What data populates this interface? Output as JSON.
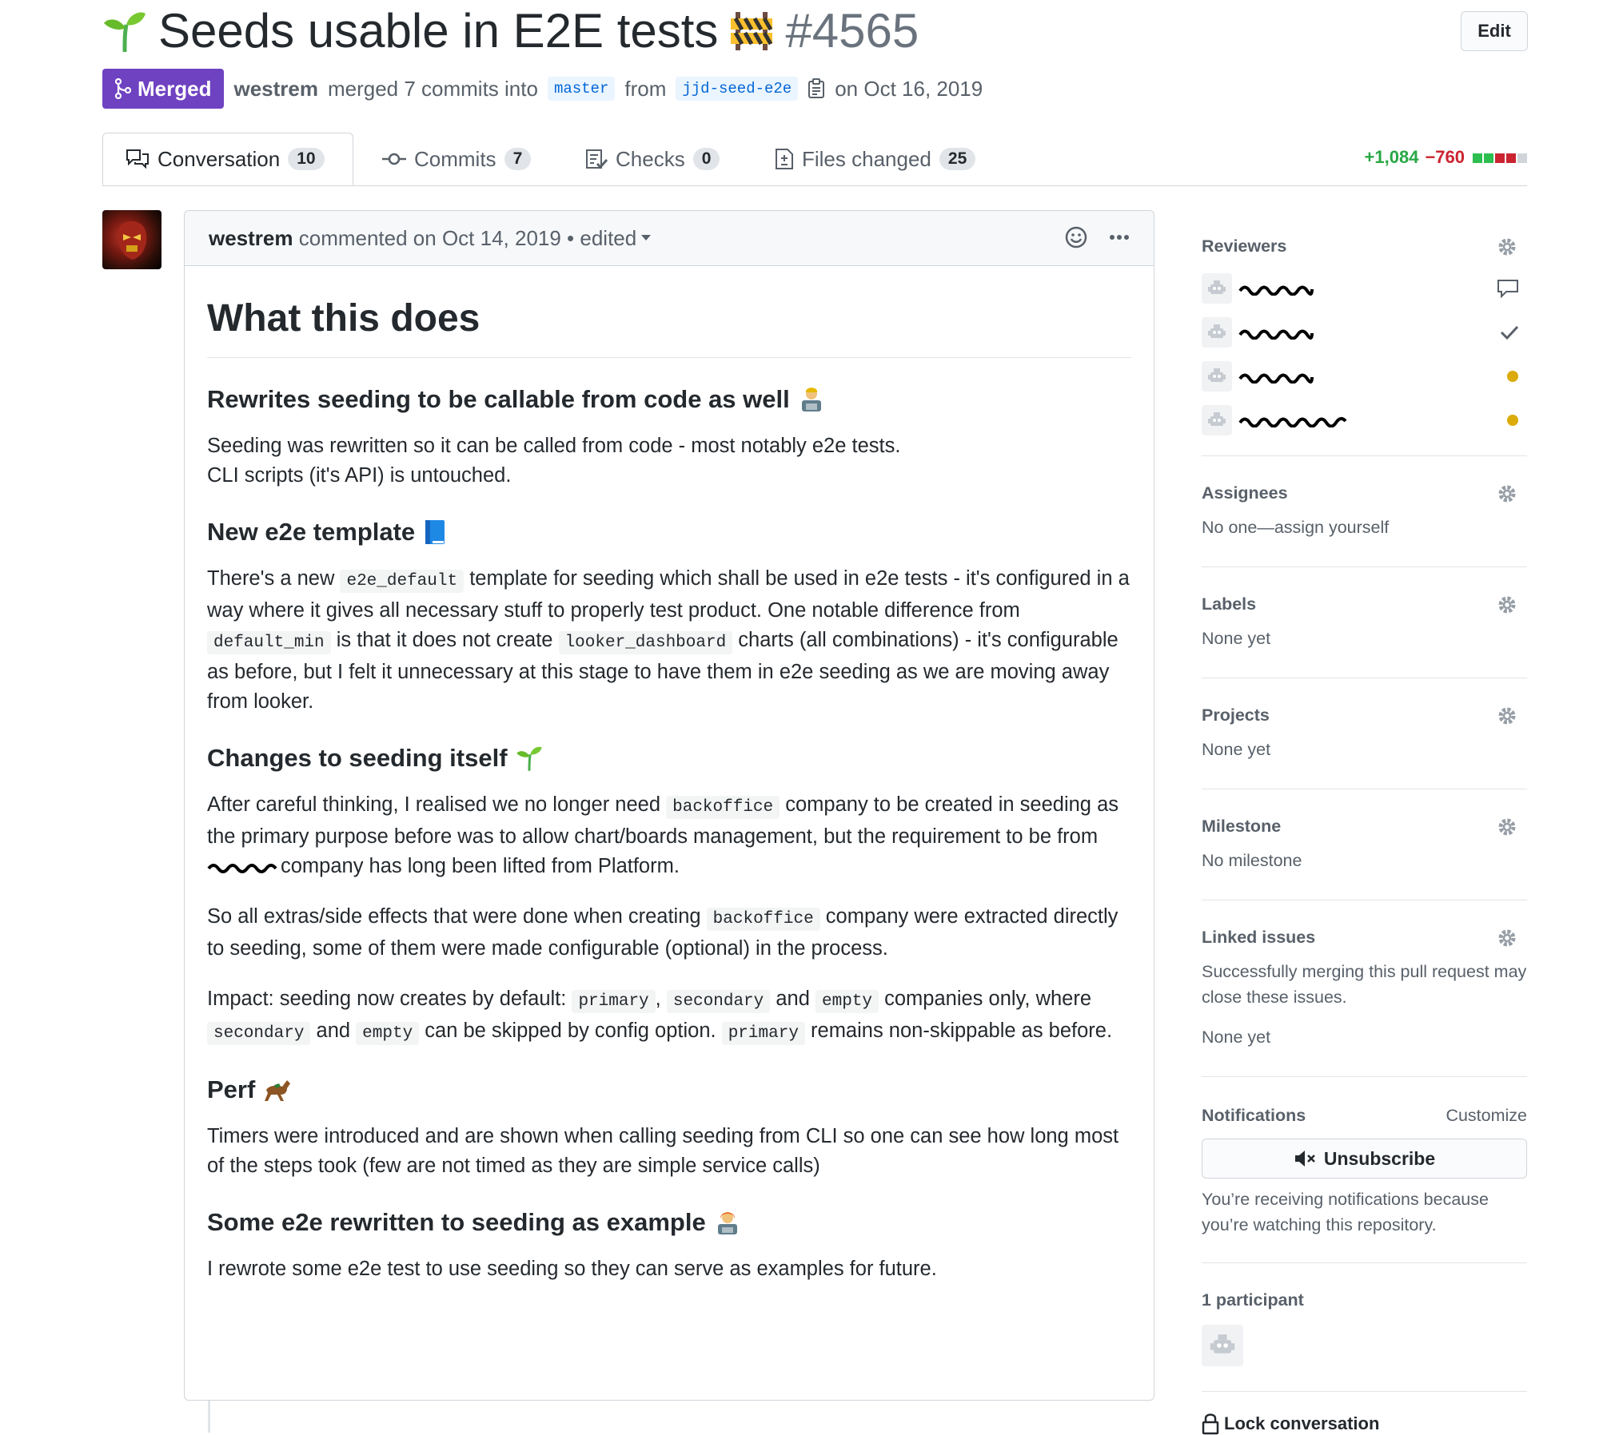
{
  "header": {
    "title": "Seeds usable in E2E tests",
    "number": "#4565",
    "edit_label": "Edit",
    "status": "Merged",
    "author": "westrem",
    "merged_text": "merged 7 commits into",
    "base_branch": "master",
    "from_text": "from",
    "head_branch": "jjd-seed-e2e",
    "date_text": "on Oct 16, 2019"
  },
  "tabs": [
    {
      "label": "Conversation",
      "count": "10",
      "icon": "comment-discussion-icon"
    },
    {
      "label": "Commits",
      "count": "7",
      "icon": "git-commit-icon"
    },
    {
      "label": "Checks",
      "count": "0",
      "icon": "checklist-icon"
    },
    {
      "label": "Files changed",
      "count": "25",
      "icon": "file-diff-icon"
    }
  ],
  "diffstat": {
    "additions": "+1,084",
    "deletions": "−760"
  },
  "comment": {
    "author": "westrem",
    "meta": "commented on Oct 14, 2019",
    "edited": "edited",
    "h1": "What this does",
    "sections": {
      "s1": {
        "heading": "Rewrites seeding to be callable from code as well",
        "p1_line1": "Seeding was rewritten so it can be called from code - most notably e2e tests.",
        "p1_line2": "CLI scripts (it's API) is untouched."
      },
      "s2": {
        "heading": "New e2e template",
        "p_a": "There's a new",
        "code_a": "e2e_default",
        "p_b": "template for seeding which shall be used in e2e tests - it's configured in a way where it gives all necessary stuff to properly test product. One notable difference from",
        "code_b": "default_min",
        "p_c": "is that it does not create",
        "code_c": "looker_dashboard",
        "p_d": "charts (all combinations) - it's configurable as before, but I felt it unnecessary at this stage to have them in e2e seeding as we are moving away from looker."
      },
      "s3": {
        "heading": "Changes to seeding itself",
        "p1_a": "After careful thinking, I realised we no longer need",
        "p1_code": "backoffice",
        "p1_b": "company to be created in seeding as the primary purpose before was to allow chart/boards management, but the requirement to be from",
        "p1_c": "company has long been lifted from Platform.",
        "p2_a": "So all extras/side effects that were done when creating",
        "p2_code": "backoffice",
        "p2_b": "company were extracted directly to seeding, some of them were made configurable (optional) in the process.",
        "p3_a": "Impact: seeding now creates by default:",
        "p3_code1": "primary",
        "p3_comma": ",",
        "p3_code2": "secondary",
        "p3_and1": "and",
        "p3_code3": "empty",
        "p3_b": "companies only, where",
        "p3_code4": "secondary",
        "p3_and2": "and",
        "p3_code5": "empty",
        "p3_c": "can be skipped by config option.",
        "p3_code6": "primary",
        "p3_d": "remains non-skippable as before."
      },
      "s4": {
        "heading": "Perf",
        "p": "Timers were introduced and are shown when calling seeding from CLI so one can see how long most of the steps took (few are not timed as they are simple service calls)"
      },
      "s5": {
        "heading": "Some e2e rewritten to seeding as example",
        "p": "I rewrote some e2e test to use seeding so they can serve as examples for future."
      }
    }
  },
  "sidebar": {
    "reviewers": {
      "title": "Reviewers",
      "statuses": [
        "commented",
        "approved",
        "pending",
        "pending"
      ]
    },
    "assignees": {
      "title": "Assignees",
      "value": "No one—assign yourself"
    },
    "labels": {
      "title": "Labels",
      "value": "None yet"
    },
    "projects": {
      "title": "Projects",
      "value": "None yet"
    },
    "milestone": {
      "title": "Milestone",
      "value": "No milestone"
    },
    "linked_issues": {
      "title": "Linked issues",
      "desc": "Successfully merging this pull request may close these issues.",
      "value": "None yet"
    },
    "notifications": {
      "title": "Notifications",
      "customize": "Customize",
      "button": "Unsubscribe",
      "desc": "You’re receiving notifications because you’re watching this repository."
    },
    "participants": {
      "title": "1 participant"
    },
    "lock": {
      "label": "Lock conversation"
    }
  },
  "colors": {
    "merged": "#6f42c1",
    "additions": "#28a745",
    "deletions": "#cb2431",
    "pending": "#dbab09",
    "link": "#0366d6"
  }
}
